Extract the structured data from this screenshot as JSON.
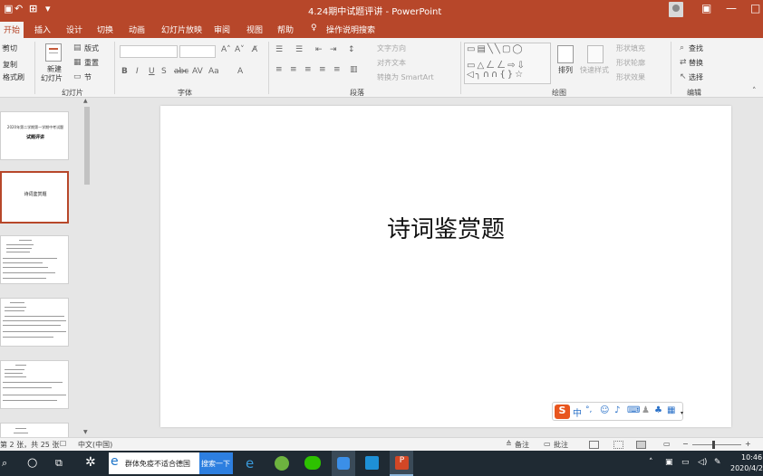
{
  "window": {
    "title": "4.24期中试题评讲 - PowerPoint",
    "quick_access": [
      "⌂",
      "↶",
      "↷"
    ]
  },
  "tabs": [
    "开始",
    "插入",
    "设计",
    "切换",
    "动画",
    "幻灯片放映",
    "审阅",
    "视图",
    "帮助",
    "操作说明搜索"
  ],
  "ribbon": {
    "clipboard": {
      "cut": "剪切",
      "copy": "复制",
      "format_painter": "格式刷"
    },
    "slides": {
      "new_slide": "新建",
      "new_slide_2": "幻灯片",
      "layout": "版式",
      "reset": "重置",
      "section": "节",
      "group": "幻灯片"
    },
    "font": {
      "group": "字体"
    },
    "paragraph": {
      "text_direction": "文字方向",
      "align_text": "对齐文本",
      "smartart": "转换为 SmartArt",
      "group": "段落"
    },
    "drawing": {
      "arrange": "排列",
      "quick_styles": "快速样式",
      "shape_fill": "形状填充",
      "shape_outline": "形状轮廓",
      "shape_effects": "形状效果",
      "group": "绘图"
    },
    "editing": {
      "find": "查找",
      "replace": "替换",
      "select": "选择",
      "group": "编辑"
    }
  },
  "slide": {
    "title": "诗词鉴赏题"
  },
  "thumbnails": {
    "t1_line1": "2020年第二学期第一学期中考试题",
    "t1_line2": "试题评讲",
    "t2": "诗词鉴赏题"
  },
  "ime": {
    "logo": "S",
    "mode": "中",
    "punct": "°,"
  },
  "status": {
    "slide_info": "第 2 张，共 25 张",
    "language": "中文(中国)",
    "notes": "备注",
    "comments": "批注"
  },
  "taskbar": {
    "search_text": "群体免疫不适合德国",
    "search_button": "搜索一下",
    "time": "10:46",
    "date": "2020/4/2"
  }
}
